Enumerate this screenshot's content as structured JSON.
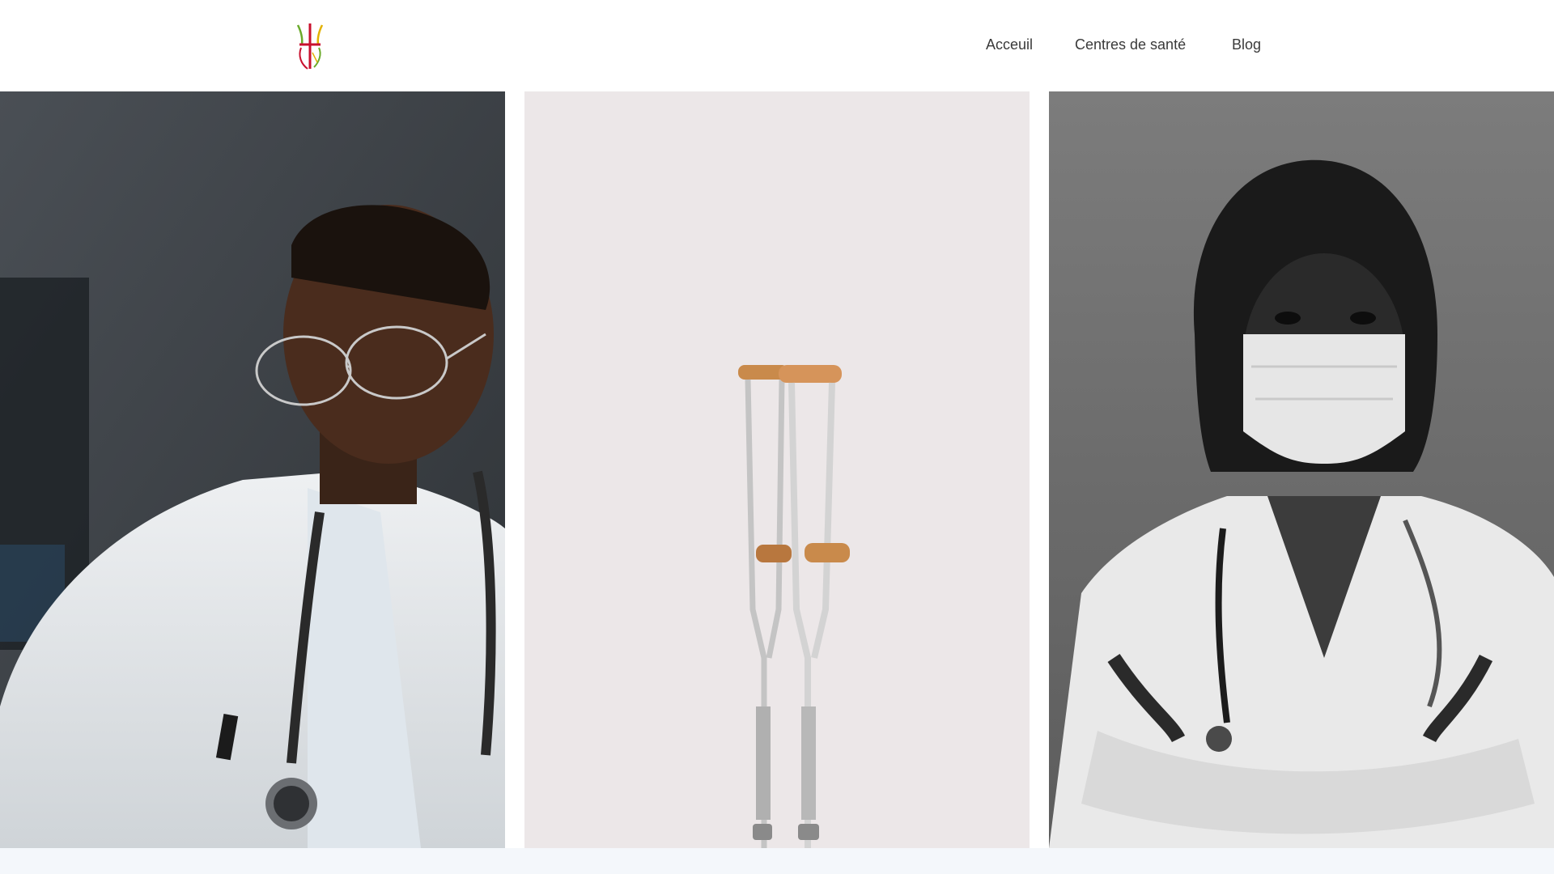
{
  "header": {
    "logo_icon": "medical-cross-logo",
    "nav": [
      {
        "label": "Acceuil"
      },
      {
        "label": "Centres de santé"
      },
      {
        "label": "Blog"
      }
    ]
  },
  "gallery": {
    "photos": [
      {
        "subject": "doctor-with-glasses-and-stethoscope",
        "tone": "color"
      },
      {
        "subject": "crutches-against-wall",
        "tone": "color"
      },
      {
        "subject": "masked-doctor-arms-crossed",
        "tone": "grayscale"
      }
    ]
  },
  "colors": {
    "nav_text": "#3a3a3a",
    "background": "#ffffff",
    "footer_band": "#f4f7fb",
    "logo_red": "#c8102e",
    "logo_green": "#6aaa2a",
    "logo_yellow": "#e2b100"
  }
}
